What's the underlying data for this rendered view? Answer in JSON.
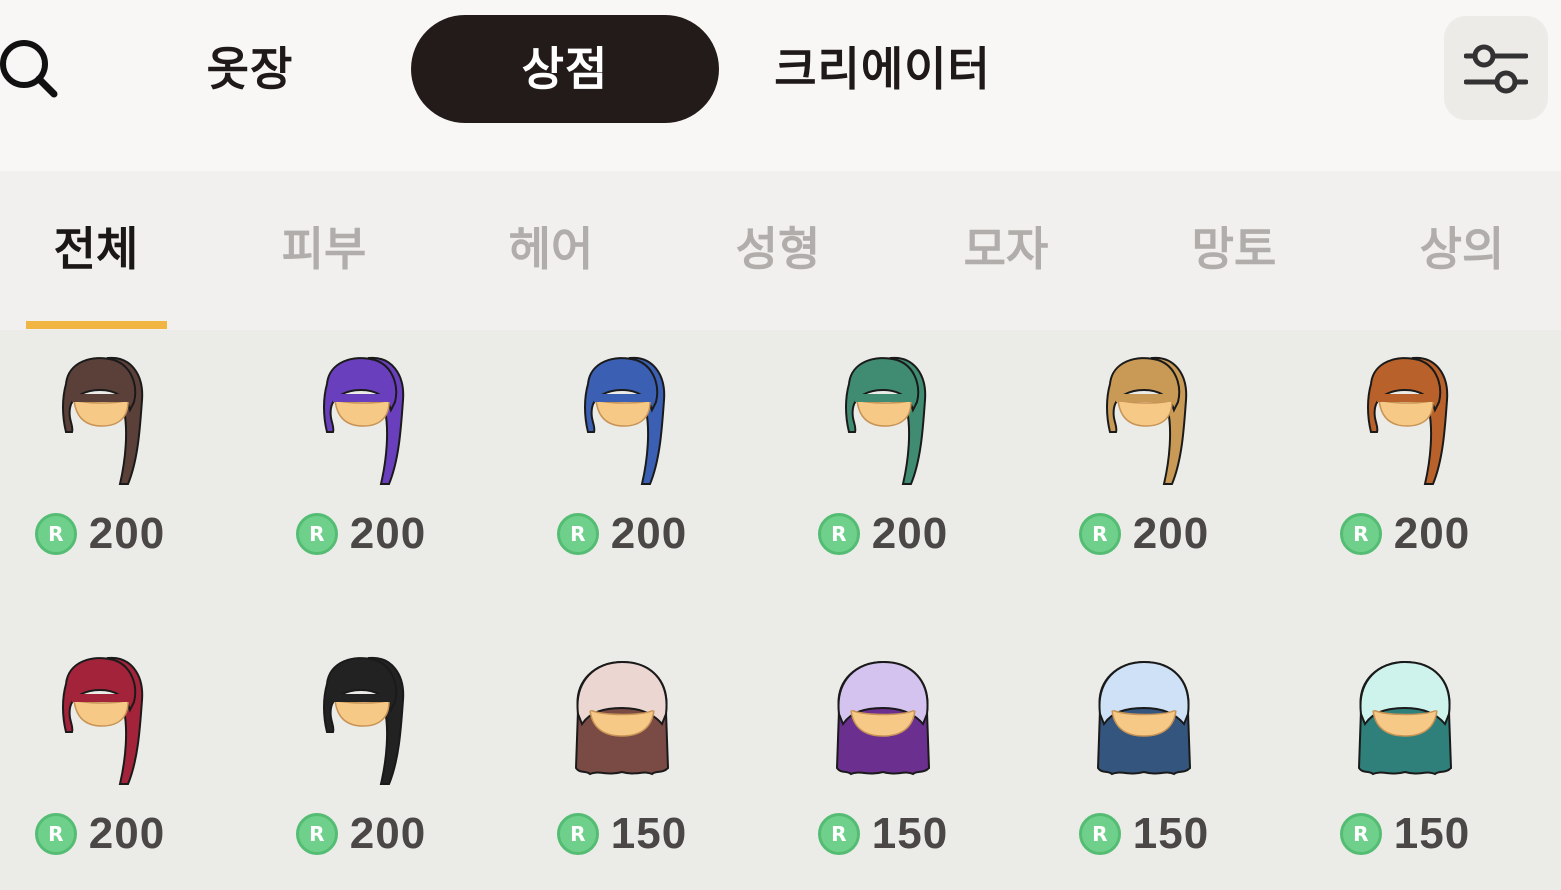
{
  "nav": {
    "tabs": [
      {
        "id": "wardrobe",
        "label": "옷장"
      },
      {
        "id": "shop",
        "label": "상점",
        "selected": true
      },
      {
        "id": "creator",
        "label": "크리에이터"
      }
    ],
    "search_icon": "search-icon",
    "filter_icon": "sliders-icon"
  },
  "categories": {
    "items": [
      "전체",
      "피부",
      "헤어",
      "성형",
      "모자",
      "망토",
      "상의"
    ],
    "selected": "전체",
    "accent_color": "#f0b543"
  },
  "currency": {
    "icon": "r-coin-icon",
    "symbol": "R",
    "color": "#6fd08b"
  },
  "items": [
    {
      "type": "ponytail",
      "hair_color": "#5b4039",
      "price": "200"
    },
    {
      "type": "ponytail",
      "hair_color": "#6a3fbd",
      "price": "200"
    },
    {
      "type": "ponytail",
      "hair_color": "#3a5fb3",
      "price": "200"
    },
    {
      "type": "ponytail",
      "hair_color": "#3f8c73",
      "price": "200"
    },
    {
      "type": "ponytail",
      "hair_color": "#c89a56",
      "price": "200"
    },
    {
      "type": "ponytail",
      "hair_color": "#b9612a",
      "price": "200"
    },
    {
      "type": "ponytail",
      "hair_color": "#a3243a",
      "price": "200"
    },
    {
      "type": "ponytail",
      "hair_color": "#222222",
      "price": "200"
    },
    {
      "type": "long-bob",
      "hair_color": "#ebd6d2",
      "tip_color": "#7a4a44",
      "price": "150"
    },
    {
      "type": "long-bob",
      "hair_color": "#d5c3ef",
      "tip_color": "#6b2f90",
      "price": "150"
    },
    {
      "type": "long-bob",
      "hair_color": "#cfe1f6",
      "tip_color": "#34567e",
      "price": "150"
    },
    {
      "type": "long-bob",
      "hair_color": "#cdf3ec",
      "tip_color": "#2f7f7b",
      "price": "150"
    }
  ]
}
